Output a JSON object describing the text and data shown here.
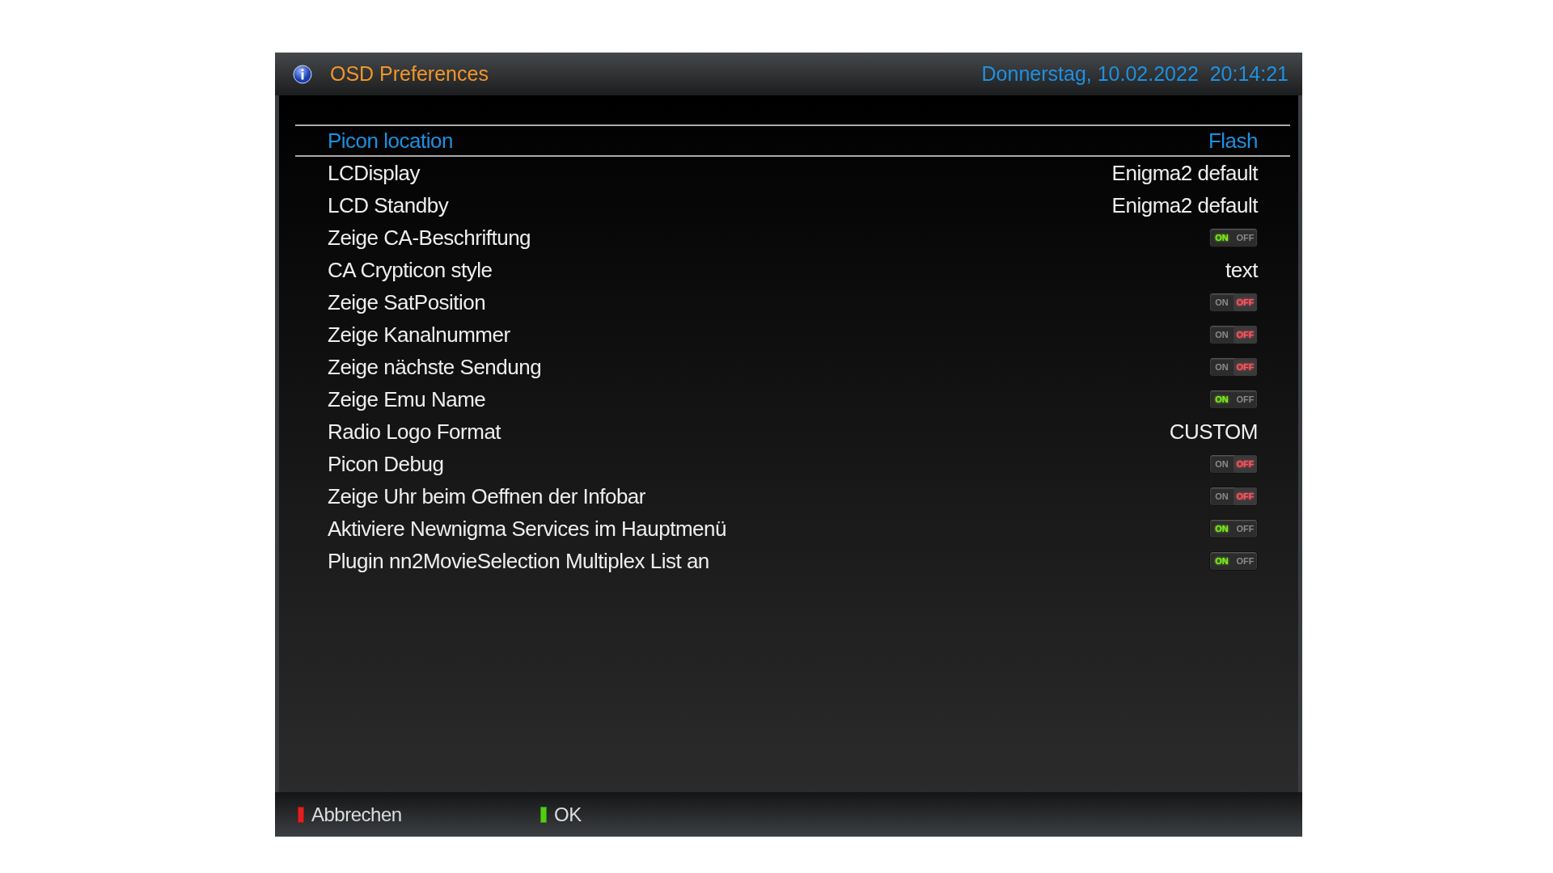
{
  "header": {
    "title": "OSD Preferences",
    "datetime": "Donnerstag, 10.02.2022  20:14:21"
  },
  "settings": [
    {
      "label": "Picon location",
      "kind": "text",
      "value": "Flash",
      "selected": true
    },
    {
      "label": "LCDisplay",
      "kind": "text",
      "value": "Enigma2 default",
      "selected": false
    },
    {
      "label": "LCD Standby",
      "kind": "text",
      "value": "Enigma2 default",
      "selected": false
    },
    {
      "label": "Zeige CA-Beschriftung",
      "kind": "switch",
      "on": true,
      "on_text": "ON",
      "off_text": "OFF",
      "selected": false
    },
    {
      "label": "CA Crypticon style",
      "kind": "text",
      "value": "text",
      "selected": false
    },
    {
      "label": "Zeige SatPosition",
      "kind": "switch",
      "on": false,
      "on_text": "ON",
      "off_text": "OFF",
      "selected": false
    },
    {
      "label": "Zeige Kanalnummer",
      "kind": "switch",
      "on": false,
      "on_text": "ON",
      "off_text": "OFF",
      "selected": false
    },
    {
      "label": "Zeige nächste Sendung",
      "kind": "switch",
      "on": false,
      "on_text": "ON",
      "off_text": "OFF",
      "selected": false
    },
    {
      "label": "Zeige Emu Name",
      "kind": "switch",
      "on": true,
      "on_text": "ON",
      "off_text": "OFF",
      "selected": false
    },
    {
      "label": "Radio Logo Format",
      "kind": "text",
      "value": "CUSTOM",
      "selected": false
    },
    {
      "label": "Picon Debug",
      "kind": "switch",
      "on": false,
      "on_text": "ON",
      "off_text": "OFF",
      "selected": false
    },
    {
      "label": "Zeige Uhr beim Oeffnen der Infobar",
      "kind": "switch",
      "on": false,
      "on_text": "ON",
      "off_text": "OFF",
      "selected": false
    },
    {
      "label": "Aktiviere Newnigma Services im Hauptmenü",
      "kind": "switch",
      "on": true,
      "on_text": "ON",
      "off_text": "OFF",
      "selected": false
    },
    {
      "label": "Plugin nn2MovieSelection Multiplex List an",
      "kind": "switch",
      "on": true,
      "on_text": "ON",
      "off_text": "OFF",
      "selected": false
    }
  ],
  "footer": [
    {
      "label": "Abbrechen",
      "color": "#e02020"
    },
    {
      "label": "OK",
      "color": "#50d010"
    }
  ]
}
